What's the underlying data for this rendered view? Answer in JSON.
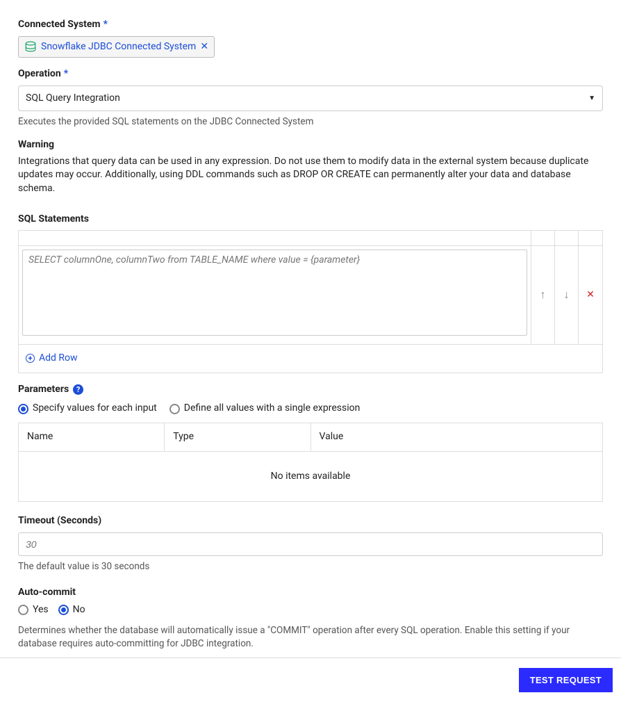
{
  "connectedSystem": {
    "label": "Connected System",
    "chip": {
      "text": "Snowflake JDBC Connected System"
    }
  },
  "operation": {
    "label": "Operation",
    "selected": "SQL Query Integration",
    "helper": "Executes the provided SQL statements on the JDBC Connected System"
  },
  "warning": {
    "title": "Warning",
    "text": "Integrations that query data can be used in any expression. Do not use them to modify data in the external system because duplicate updates may occur. Additionally, using DDL commands such as DROP OR CREATE can permanently alter your data and database schema."
  },
  "sqlStatements": {
    "label": "SQL Statements",
    "placeholder": "SELECT columnOne, columnTwo from TABLE_NAME where value = {parameter}",
    "addRow": "Add Row"
  },
  "parameters": {
    "label": "Parameters",
    "radio1": "Specify values for each input",
    "radio2": "Define all values with a single expression",
    "col1": "Name",
    "col2": "Type",
    "col3": "Value",
    "empty": "No items available"
  },
  "timeout": {
    "label": "Timeout (Seconds)",
    "placeholder": "30",
    "helper": "The default value is 30 seconds"
  },
  "autocommit": {
    "label": "Auto-commit",
    "yes": "Yes",
    "no": "No",
    "helper": "Determines whether the database will automatically issue a \"COMMIT\" operation after every SQL operation. Enable this setting if your database requires auto-committing for JDBC integration."
  },
  "footer": {
    "testButton": "TEST REQUEST"
  }
}
